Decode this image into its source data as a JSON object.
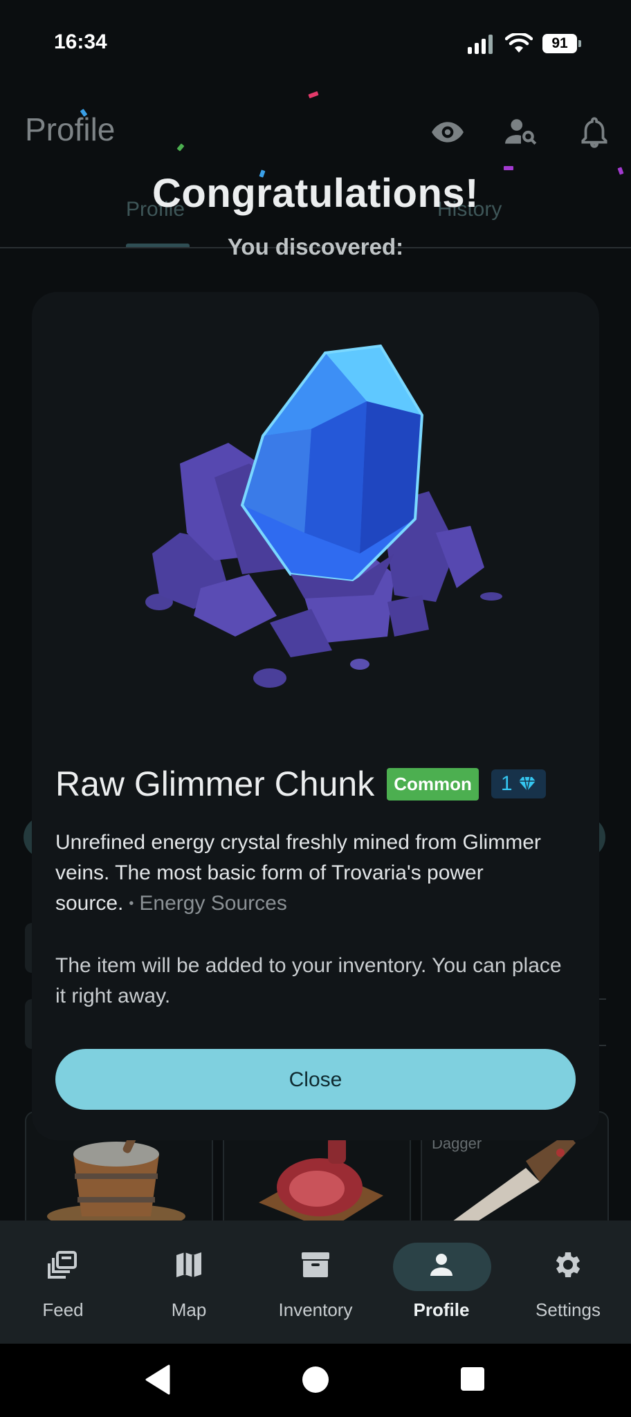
{
  "status_bar": {
    "time": "16:34",
    "battery": "91"
  },
  "background_app": {
    "title": "Profile",
    "tabs": [
      "Profile",
      "History"
    ],
    "card_label": "Dagger"
  },
  "overlay": {
    "heading": "Congratulations!",
    "subheading": "You discovered:"
  },
  "item": {
    "name": "Raw Glimmer Chunk",
    "rarity": "Common",
    "value": "1",
    "description": "Unrefined energy crystal freshly mined from Glimmer veins. The most basic form of Trovaria's power source.",
    "category": "Energy Sources",
    "note": "The item will be added to your inventory. You can place it right away.",
    "close_label": "Close"
  },
  "bottom_nav": {
    "items": [
      {
        "label": "Feed",
        "icon": "feed-icon"
      },
      {
        "label": "Map",
        "icon": "map-icon"
      },
      {
        "label": "Inventory",
        "icon": "inventory-icon"
      },
      {
        "label": "Profile",
        "icon": "person-icon",
        "active": true
      },
      {
        "label": "Settings",
        "icon": "gear-icon"
      }
    ]
  },
  "colors": {
    "accent": "#7fd0df",
    "rarity_common": "#4caf50",
    "dialog_bg": "#111518"
  }
}
